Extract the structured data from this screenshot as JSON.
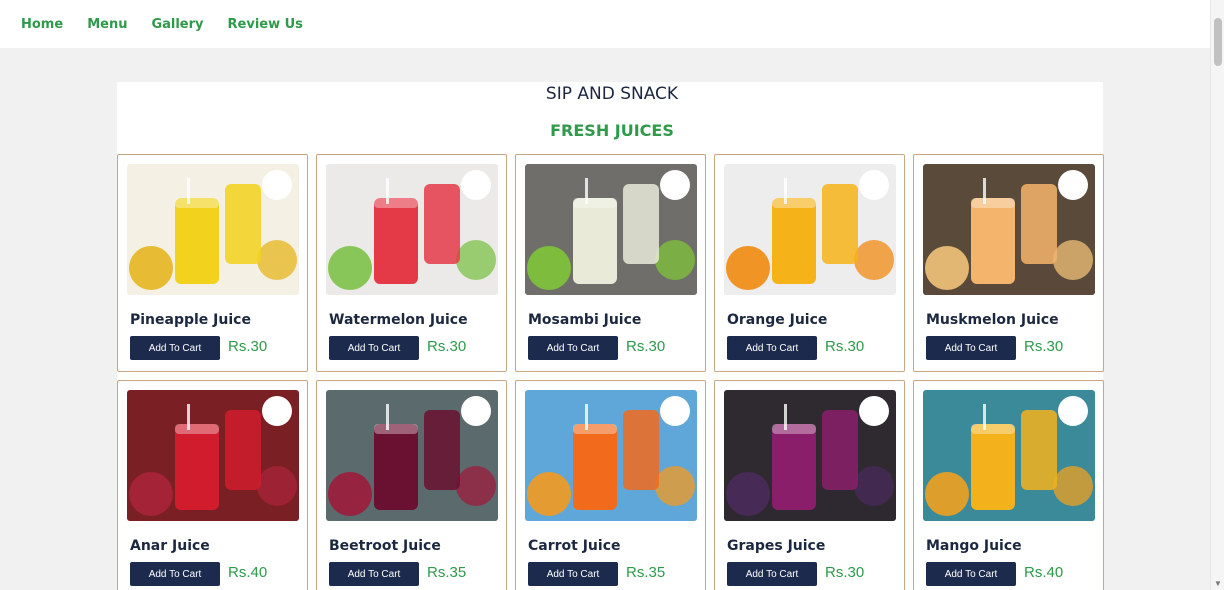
{
  "nav": {
    "items": [
      "Home",
      "Menu",
      "Gallery",
      "Review Us"
    ]
  },
  "header": {
    "brand": "SIP AND SNACK",
    "section_title": "FRESH JUICES"
  },
  "products": [
    {
      "name": "Pineapple Juice",
      "button": "Add To Cart",
      "price": "Rs.30",
      "bg": "#f4f1e4",
      "juice": "#f2d21c",
      "accent": "#e6b51f"
    },
    {
      "name": "Watermelon Juice",
      "button": "Add To Cart",
      "price": "Rs.30",
      "bg": "#eceae8",
      "juice": "#e43a48",
      "accent": "#7ec24a"
    },
    {
      "name": "Mosambi Juice",
      "button": "Add To Cart",
      "price": "Rs.30",
      "bg": "#6f6e6a",
      "juice": "#e9ead8",
      "accent": "#7fc43a"
    },
    {
      "name": "Orange Juice",
      "button": "Add To Cart",
      "price": "Rs.30",
      "bg": "#ededed",
      "juice": "#f6b319",
      "accent": "#f08a10"
    },
    {
      "name": "Muskmelon Juice",
      "button": "Add To Cart",
      "price": "Rs.30",
      "bg": "#5a4a3a",
      "juice": "#f4b46c",
      "accent": "#f1c27a"
    },
    {
      "name": "Anar Juice",
      "button": "Add To Cart",
      "price": "Rs.40",
      "bg": "#7a1f24",
      "juice": "#d01c2c",
      "accent": "#a8243a"
    },
    {
      "name": "Beetroot Juice",
      "button": "Add To Cart",
      "price": "Rs.35",
      "bg": "#5b6a6c",
      "juice": "#6a1030",
      "accent": "#9c1c3c"
    },
    {
      "name": "Carrot Juice",
      "button": "Add To Cart",
      "price": "Rs.35",
      "bg": "#5fa7d8",
      "juice": "#f26b1d",
      "accent": "#f39a20"
    },
    {
      "name": "Grapes Juice",
      "button": "Add To Cart",
      "price": "Rs.30",
      "bg": "#2e2a30",
      "juice": "#8a1e6a",
      "accent": "#4a2a5a"
    },
    {
      "name": "Mango Juice",
      "button": "Add To Cart",
      "price": "Rs.40",
      "bg": "#3a8a9a",
      "juice": "#f3b11c",
      "accent": "#f0a020"
    }
  ],
  "colors": {
    "accent_green": "#2e9a4a",
    "navy": "#1c2a4d",
    "card_border": "#c8a882"
  }
}
